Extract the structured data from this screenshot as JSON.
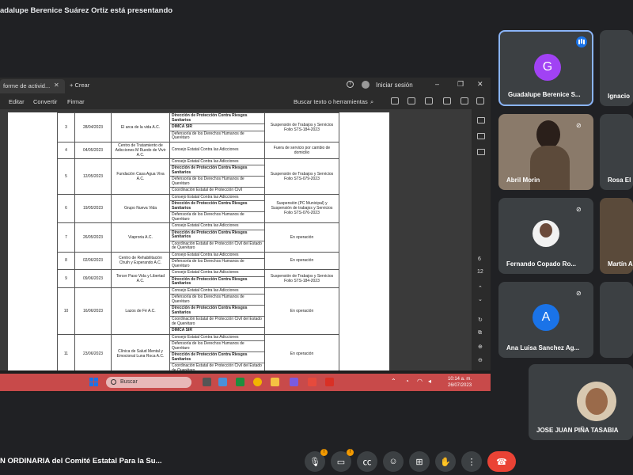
{
  "presenter_banner": "adalupe Berenice Suárez Ortiz está presentando",
  "app": {
    "tab_title": "forme de activid...",
    "new_tab": "+ Crear",
    "signin": "Iniciar sesión",
    "toolbar": {
      "edit": "Editar",
      "convert": "Convertir",
      "sign": "Firmar",
      "search": "Buscar texto o herramientas"
    },
    "rail": {
      "page_current": "6",
      "page_total": "12"
    }
  },
  "taskbar": {
    "search": "Buscar",
    "time": "10:14 a. m.",
    "date": "26/07/2023"
  },
  "table": {
    "rows": [
      {
        "num": "3",
        "date": "28/04/2023",
        "name": "El arca de la vida A.C.",
        "deps": [
          "Dirección de Protección Contra Riesgos Sanitarios",
          "DIMCA SIR",
          "Defensoría de los Derechos Humanos de Querétaro"
        ],
        "status": "Suspensión de Trabajos y Servicios Folio STS-184-2023"
      },
      {
        "num": "4",
        "date": "04/05/2023",
        "name": "Centro de Tratamiento de Adicciones M Ruedo de Vivir A.C.",
        "deps": [
          "Consejo Estatal Contra las Adicciones"
        ],
        "status": "Fuera de servicio por cambio de domicilio"
      },
      {
        "num": "5",
        "date": "12/05/2023",
        "name": "Fundación Casa Agua Viva A.C.",
        "deps": [
          "Consejo Estatal Contra las Adicciones",
          "Dirección de Protección Contra Riesgos Sanitarios",
          "Defensoría de los Derechos Humanos de Querétaro",
          "Coordinación Estatal de Protección Civil"
        ],
        "status": "Suspensión de Trabajos y Servicios Folio STS-079-2023"
      },
      {
        "num": "6",
        "date": "19/05/2023",
        "name": "Grupo Nueva Vida",
        "deps": [
          "Consejo Estatal Contra las Adicciones",
          "Dirección de Protección Contra Riesgos Sanitarios",
          "Defensoría de los Derechos Humanos de Querétaro"
        ],
        "status": "Suspensión (PC Municipal) y Suspensión de trabajos y Servicios Folio STS-076-2023"
      },
      {
        "num": "7",
        "date": "26/05/2023",
        "name": "Viaproria A.C.",
        "deps": [
          "Consejo Estatal Contra las Adicciones",
          "Dirección de Protección Contra Riesgos Sanitarios",
          "Coordinación Estatal de Protección Civil del Estado de Querétaro"
        ],
        "status": "En operación"
      },
      {
        "num": "8",
        "date": "02/06/2023",
        "name": "Centro de Rehabilitación Chuih y Esperando A.C.",
        "deps": [
          "Consejo Estatal Contra las Adicciones",
          "Defensoría de los Derechos Humanos de Querétaro"
        ],
        "status": "En operación"
      },
      {
        "num": "9",
        "date": "09/06/2023",
        "name": "Tercer Paso Vida y Libertad A.C.",
        "deps": [
          "Consejo Estatal Contra las Adicciones",
          "Dirección de Protección Contra Riesgos Sanitarios"
        ],
        "status": "Suspensión de Trabajos y Servicios Folio STS-184-2023"
      },
      {
        "num": "10",
        "date": "16/06/2023",
        "name": "Lazos de Fé A.C.",
        "deps": [
          "Consejo Estatal Contra las Adicciones",
          "Defensoría de los Derechos Humanos de Querétaro",
          "Dirección de Protección Contra Riesgos Sanitarios",
          "Coordinación Estatal de Protección Civil del Estado de Querétaro",
          "DIMCA SIR"
        ],
        "status": "En operación"
      },
      {
        "num": "11",
        "date": "23/06/2023",
        "name": "Clínica de Salud Mental y Emocional Luna Roca A.C.",
        "deps": [
          "Consejo Estatal Contra las Adicciones",
          "Defensoría de los Derechos Humanos de Querétaro",
          "Dirección de Protección Contra Riesgos Sanitarios",
          "Coordinación Estatal de Protección Civil del Estado de Querétaro"
        ],
        "status": "En operación"
      }
    ]
  },
  "participants": [
    {
      "name": "Guadalupe Berenice S...",
      "initial": "G",
      "color": "#a142f4"
    },
    {
      "name": "Ignacio"
    },
    {
      "name": "Abril Morin"
    },
    {
      "name": "Rosa El"
    },
    {
      "name": "Fernando Copado Ro..."
    },
    {
      "name": "Martín A"
    },
    {
      "name": "Ana Luisa Sanchez Ag...",
      "initial": "A",
      "color": "#1a73e8"
    },
    {
      "name": "JOSE JUAN PIÑA TASABIA"
    }
  ],
  "meeting_title": "N ORDINARIA del Comité Estatal Para la Su...",
  "controls": {
    "mic_badge": "!",
    "cam_badge": "!"
  },
  "colors": {
    "background": "#202124",
    "tile": "#3c4043",
    "accent": "#8ab4f8",
    "end_call": "#ea4335",
    "taskbar": "#c84a4a"
  }
}
